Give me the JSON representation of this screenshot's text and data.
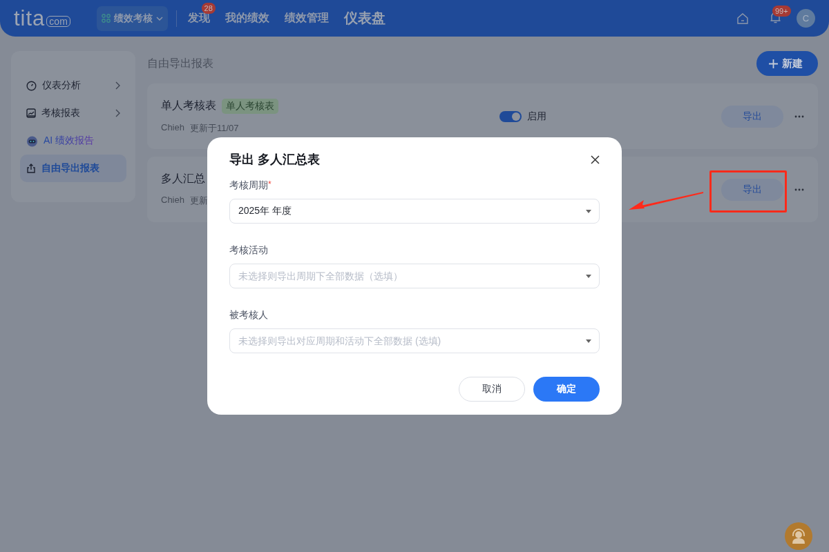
{
  "header": {
    "logo": "tita",
    "logo_suffix": "com",
    "module_switch": {
      "label": "绩效考核",
      "selected": true
    },
    "nav": [
      {
        "label": "发现",
        "badge": "28",
        "selected": false
      },
      {
        "label": "我的绩效",
        "selected": false
      },
      {
        "label": "绩效管理",
        "selected": false
      },
      {
        "label": "仪表盘",
        "selected": true
      }
    ],
    "notification_badge": "99+",
    "avatar_initial": "C"
  },
  "sidebar": {
    "items": [
      {
        "label": "仪表分析",
        "kind": "normal",
        "expandable": true,
        "selected": false
      },
      {
        "label": "考核报表",
        "kind": "normal",
        "expandable": true,
        "selected": false
      },
      {
        "label": "AI 绩效报告",
        "kind": "ai",
        "expandable": false,
        "selected": false
      },
      {
        "label": "自由导出报表",
        "kind": "normal",
        "expandable": false,
        "selected": true
      }
    ]
  },
  "page_title": "自由导出报表",
  "new_button": "新建",
  "reports": [
    {
      "title": "单人考核表",
      "tag": "单人考核表",
      "author": "Chieh",
      "updated": "更新于11/07",
      "toggle": {
        "on": true,
        "label": "启用"
      },
      "export_button": "导出",
      "highlighted": false
    },
    {
      "title": "多人汇总",
      "author": "Chieh",
      "updated": "更新",
      "export_button": "导出",
      "highlighted": true
    }
  ],
  "modal": {
    "title": "导出 多人汇总表",
    "fields": [
      {
        "label": "考核周期",
        "required_mark": "*",
        "value": "2025年 年度"
      },
      {
        "label": "考核活动",
        "placeholder": "未选择则导出周期下全部数据（选填）"
      },
      {
        "label": "被考核人",
        "placeholder": "未选择则导出对应周期和活动下全部数据 (选填)"
      }
    ],
    "buttons": [
      {
        "label": "取消",
        "kind": "secondary"
      },
      {
        "label": "确定",
        "kind": "primary"
      }
    ]
  }
}
